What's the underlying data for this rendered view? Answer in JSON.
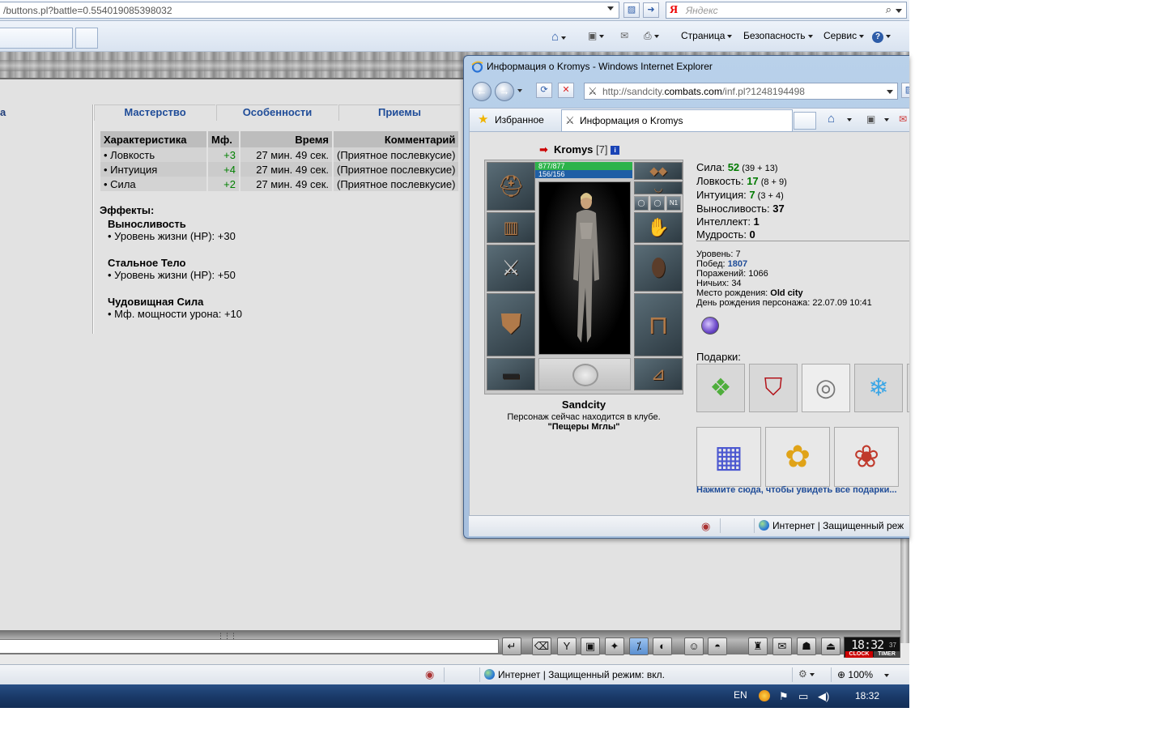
{
  "main_window": {
    "address": "/buttons.pl?battle=0.554019085398032",
    "search_placeholder": "Яндекс",
    "search_logo": "Я",
    "command_bar": {
      "page": "Страница",
      "security": "Безопасность",
      "service": "Сервис",
      "help": "?"
    },
    "tabs": {
      "left_cut_label": "а",
      "mastery": "Мастерство",
      "features": "Особенности",
      "techniques": "Приемы"
    },
    "table": {
      "headers": [
        "Характеристика",
        "Мф.",
        "Время",
        "Комментарий"
      ],
      "rows": [
        {
          "name": "• Ловкость",
          "mf": "+3",
          "time": "27 мин. 49 сек.",
          "comment": "(Приятное послевкусие)"
        },
        {
          "name": "• Интуиция",
          "mf": "+4",
          "time": "27 мин. 49 сек.",
          "comment": "(Приятное послевкусие)"
        },
        {
          "name": "• Сила",
          "mf": "+2",
          "time": "27 мин. 49 сек.",
          "comment": "(Приятное послевкусие)"
        }
      ]
    },
    "effects": {
      "title": "Эффекты:",
      "items": [
        {
          "name": "Выносливость",
          "value": "• Уровень жизни (HP): +30"
        },
        {
          "name": "Стальное Тело",
          "value": "• Уровень жизни (HP): +50"
        },
        {
          "name": "Чудовищная Сила",
          "value": "• Мф. мощности урона: +10"
        }
      ]
    },
    "clock": {
      "time": "18:32",
      "seconds": "37",
      "clock_label": "CLOCK",
      "timer_label": "TIMER"
    },
    "status": {
      "zone": "Интернет | Защищенный режим: вкл.",
      "zoom": "100%"
    },
    "taskbar": {
      "lang": "EN",
      "time": "18:32"
    }
  },
  "popup": {
    "title": "Информация о Kromys - Windows Internet Explorer",
    "address_prefix": "http://sandcity.",
    "address_domain": "combats.com",
    "address_suffix": "/inf.pl?1248194498",
    "favorites": "Избранное",
    "tab_title": "Информация о Kromys",
    "status_zone": "Интернет | Защищенный реж",
    "character": {
      "name": "Kromys",
      "level": "[7]",
      "info_badge": "i",
      "hp": "877/877",
      "mana": "156/156",
      "city": "Sandcity",
      "club_text": "Персонаж сейчас находится в клубе.",
      "club_name": "\"Пещеры Мглы\"",
      "slot_badge": "N1"
    },
    "stats": [
      {
        "label": "Сила: ",
        "value": "52",
        "sub": " (39 + 13)",
        "up": true
      },
      {
        "label": "Ловкость: ",
        "value": "17",
        "sub": " (8 + 9)",
        "up": true
      },
      {
        "label": "Интуиция: ",
        "value": "7",
        "sub": " (3 + 4)",
        "up": true
      },
      {
        "label": "Выносливость: ",
        "value": "37",
        "sub": "",
        "up": false
      },
      {
        "label": "Интеллект: ",
        "value": "1",
        "sub": "",
        "up": false
      },
      {
        "label": "Мудрость: ",
        "value": "0",
        "sub": "",
        "up": false
      }
    ],
    "records": [
      {
        "label": "Уровень: ",
        "value": "7",
        "style": "plain"
      },
      {
        "label": "Побед: ",
        "value": "1807",
        "style": "blue"
      },
      {
        "label": "Поражений: ",
        "value": "1066",
        "style": "plain"
      },
      {
        "label": "Ничьих: ",
        "value": "34",
        "style": "plain"
      },
      {
        "label": "Место рождения: ",
        "value": "Old city",
        "style": "bold"
      },
      {
        "label": "День рождения персонажа: ",
        "value": "22.07.09 10:41",
        "style": "plain"
      }
    ],
    "gifts_title": "Подарки:",
    "gifts_link": "Нажмите сюда, чтобы увидеть все подарки...",
    "icons": {
      "gifts": [
        "green-scroll-gift-icon",
        "red-banner-gift-icon",
        "silver-ring-gift-icon",
        "ice-dolphins-gift-icon",
        "blue-gift-box-icon",
        "flower-basket-gift-icon",
        "red-roses-gift-icon"
      ]
    }
  },
  "colors": {
    "tab_blue": "#1f4c98",
    "positive_green": "#008000",
    "content_gray": "#e2e2e2",
    "taskbar_blue": "#1a3a69"
  }
}
